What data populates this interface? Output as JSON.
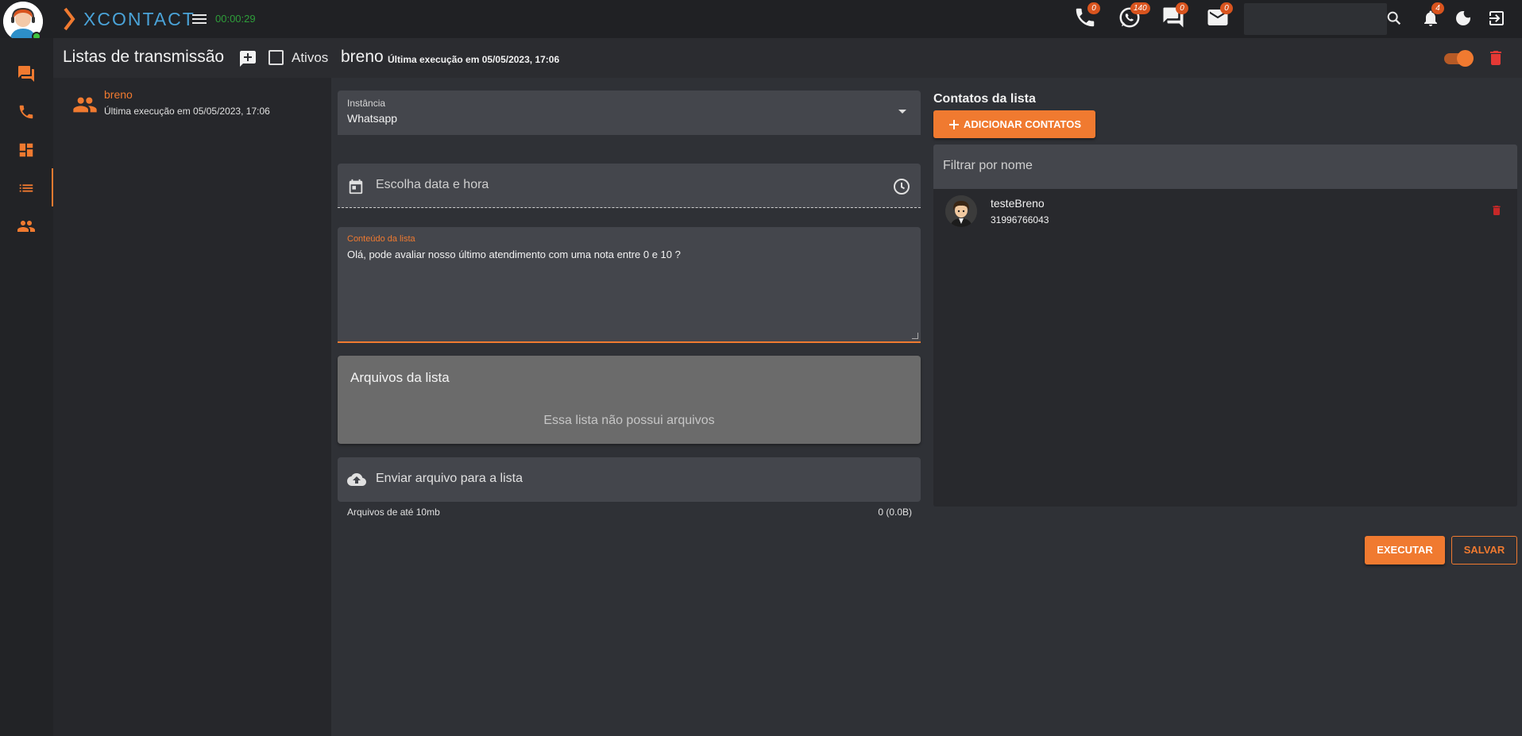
{
  "header": {
    "logo_text": "XCONTACT",
    "timer": "00:00:29",
    "badges": {
      "phone": "0",
      "whatsapp": "140",
      "chat": "0",
      "email": "0",
      "notifications": "4"
    },
    "search_placeholder": ""
  },
  "sidebar": {
    "items": [
      {
        "icon": "chat-icon"
      },
      {
        "icon": "phone-icon"
      },
      {
        "icon": "dashboard-icon"
      },
      {
        "icon": "list-icon",
        "active": true
      },
      {
        "icon": "people-icon"
      }
    ]
  },
  "lists_panel": {
    "title": "Listas de transmissão",
    "active_filter_label": "Ativos",
    "items": [
      {
        "name": "breno",
        "last_run": "Última execução em 05/05/2023, 17:06"
      }
    ]
  },
  "detail": {
    "name": "breno",
    "last_run": "Última execução em 05/05/2023, 17:06",
    "enabled": true,
    "instancia_label": "Instância",
    "instancia_value": "Whatsapp",
    "datetime_placeholder": "Escolha data e hora",
    "content_label": "Conteúdo da lista",
    "content_value": "Olá, pode avaliar nosso último atendimento com uma nota entre 0 e 10 ?",
    "files_title": "Arquivos da lista",
    "files_empty": "Essa lista não possui arquivos",
    "upload_label": "Enviar arquivo para a lista",
    "upload_limit": "Arquivos de até 10mb",
    "upload_size": "0 (0.0B)"
  },
  "contacts": {
    "title": "Contatos da lista",
    "add_button": "ADICIONAR CONTATOS",
    "filter_placeholder": "Filtrar por nome",
    "items": [
      {
        "name": "testeBreno",
        "phone": "31996766043"
      }
    ]
  },
  "actions": {
    "execute": "EXECUTAR",
    "save": "SALVAR"
  },
  "colors": {
    "accent": "#f07a30",
    "background": "#2f3136",
    "topbar": "#202124",
    "online": "#3ec43e",
    "timer": "#2e9e3a"
  }
}
